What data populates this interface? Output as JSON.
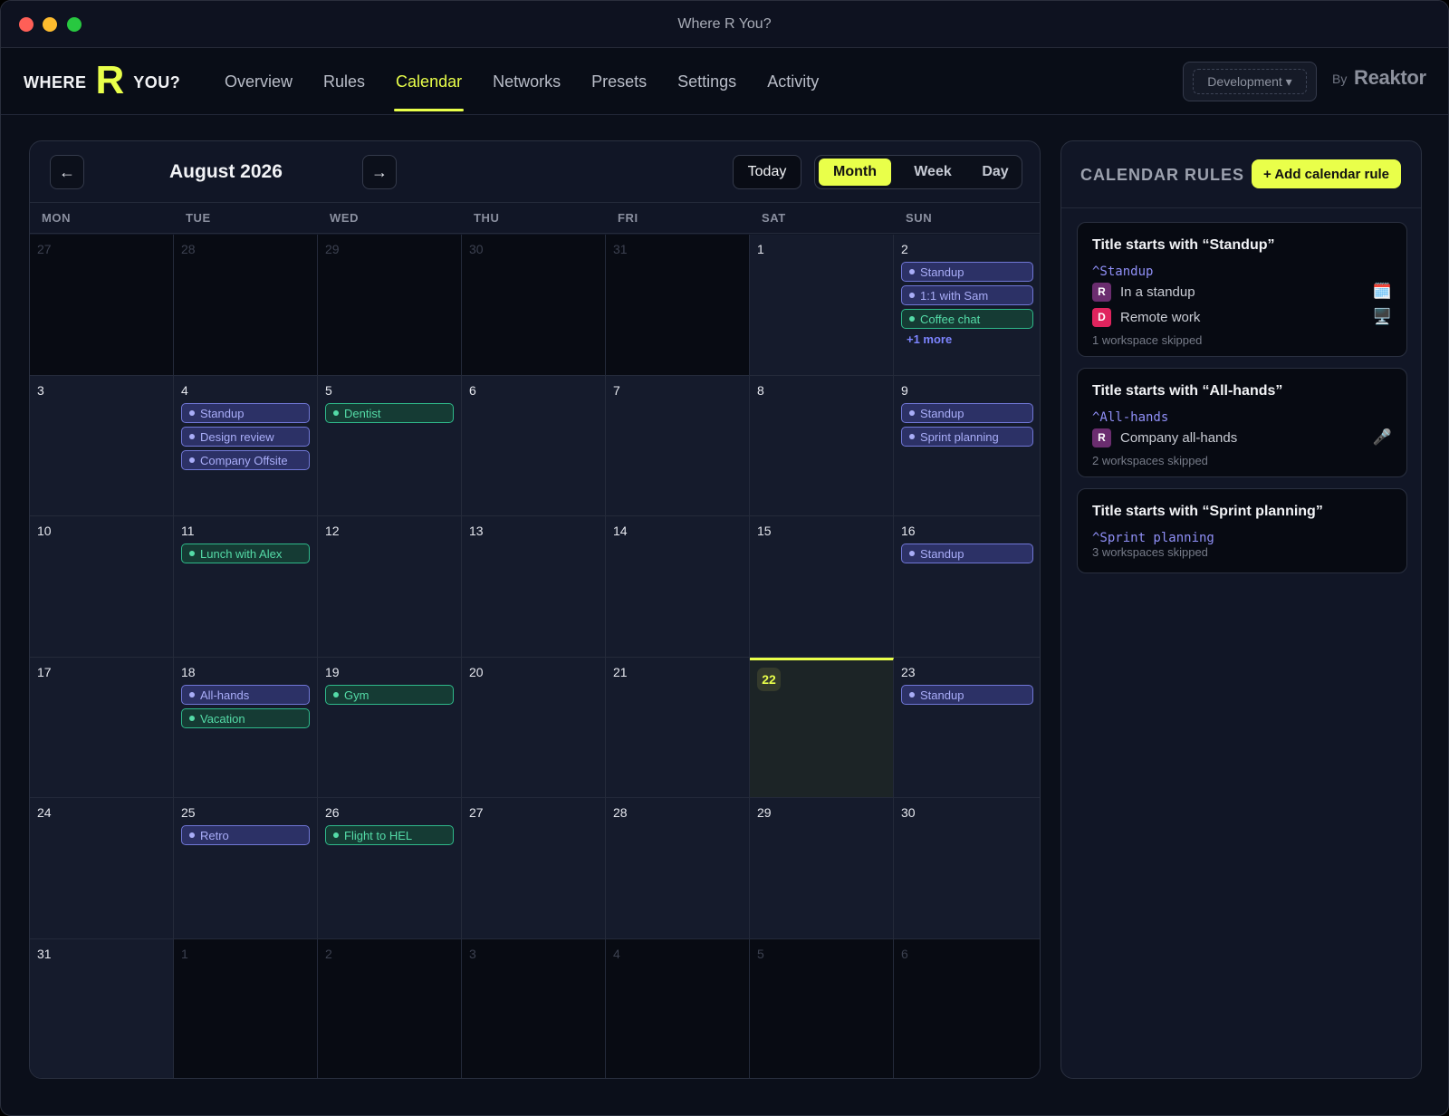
{
  "window": {
    "title": "Where R You?"
  },
  "logo": {
    "left": "WHERE",
    "mark": "R",
    "right": "YOU?"
  },
  "nav": {
    "tabs": [
      "Overview",
      "Rules",
      "Calendar",
      "Networks",
      "Presets",
      "Settings",
      "Activity"
    ],
    "active": "Calendar"
  },
  "environment": {
    "selected": "Development ▾"
  },
  "brand": {
    "by": "By",
    "name": "Reaktor"
  },
  "calendar": {
    "prev_label": "←",
    "next_label": "→",
    "month_title": "August 2026",
    "today_label": "Today",
    "views": [
      "Month",
      "Week",
      "Day"
    ],
    "active_view": "Month",
    "weekdays": [
      "MON",
      "TUE",
      "WED",
      "THU",
      "FRI",
      "SAT",
      "SUN"
    ],
    "today_day": "22",
    "more_label": "+1 more",
    "weeks": [
      [
        {
          "day": "27",
          "muted": true,
          "events": []
        },
        {
          "day": "28",
          "muted": true,
          "events": []
        },
        {
          "day": "29",
          "muted": true,
          "events": []
        },
        {
          "day": "30",
          "muted": true,
          "events": []
        },
        {
          "day": "31",
          "muted": true,
          "events": []
        },
        {
          "day": "1",
          "events": []
        },
        {
          "day": "2",
          "events": [
            {
              "title": "Standup",
              "color": "purple"
            },
            {
              "title": "1:1 with Sam",
              "color": "purple"
            },
            {
              "title": "Coffee chat",
              "color": "green"
            }
          ],
          "more": true
        }
      ],
      [
        {
          "day": "3",
          "events": []
        },
        {
          "day": "4",
          "events": [
            {
              "title": "Standup",
              "color": "purple"
            },
            {
              "title": "Design review",
              "color": "purple"
            },
            {
              "title": "Company Offsite",
              "color": "purple"
            }
          ]
        },
        {
          "day": "5",
          "events": [
            {
              "title": "Dentist",
              "color": "green"
            }
          ]
        },
        {
          "day": "6",
          "events": []
        },
        {
          "day": "7",
          "events": []
        },
        {
          "day": "8",
          "events": []
        },
        {
          "day": "9",
          "events": [
            {
              "title": "Standup",
              "color": "purple"
            },
            {
              "title": "Sprint planning",
              "color": "purple"
            }
          ]
        }
      ],
      [
        {
          "day": "10",
          "events": []
        },
        {
          "day": "11",
          "events": [
            {
              "title": "Lunch with Alex",
              "color": "green"
            }
          ]
        },
        {
          "day": "12",
          "events": []
        },
        {
          "day": "13",
          "events": []
        },
        {
          "day": "14",
          "events": []
        },
        {
          "day": "15",
          "events": []
        },
        {
          "day": "16",
          "events": [
            {
              "title": "Standup",
              "color": "purple"
            }
          ]
        }
      ],
      [
        {
          "day": "17",
          "events": []
        },
        {
          "day": "18",
          "events": [
            {
              "title": "All-hands",
              "color": "purple"
            },
            {
              "title": "Vacation",
              "color": "green"
            }
          ]
        },
        {
          "day": "19",
          "events": [
            {
              "title": "Gym",
              "color": "green"
            }
          ]
        },
        {
          "day": "20",
          "events": []
        },
        {
          "day": "21",
          "events": []
        },
        {
          "day": "22",
          "today": true,
          "events": []
        },
        {
          "day": "23",
          "events": [
            {
              "title": "Standup",
              "color": "purple"
            }
          ]
        }
      ],
      [
        {
          "day": "24",
          "events": []
        },
        {
          "day": "25",
          "events": [
            {
              "title": "Retro",
              "color": "purple"
            }
          ]
        },
        {
          "day": "26",
          "events": [
            {
              "title": "Flight to HEL",
              "color": "green"
            }
          ]
        },
        {
          "day": "27",
          "events": []
        },
        {
          "day": "28",
          "events": []
        },
        {
          "day": "29",
          "events": []
        },
        {
          "day": "30",
          "events": []
        }
      ],
      [
        {
          "day": "31",
          "events": []
        },
        {
          "day": "1",
          "muted": true,
          "events": []
        },
        {
          "day": "2",
          "muted": true,
          "events": []
        },
        {
          "day": "3",
          "muted": true,
          "events": []
        },
        {
          "day": "4",
          "muted": true,
          "events": []
        },
        {
          "day": "5",
          "muted": true,
          "events": []
        },
        {
          "day": "6",
          "muted": true,
          "events": []
        }
      ]
    ]
  },
  "rules_panel": {
    "title": "CALENDAR RULES",
    "add_label": "+ Add calendar rule",
    "rules": [
      {
        "title": "Title starts with “Standup”",
        "pattern": "^Standup",
        "workspaces": [
          {
            "initial": "R",
            "label": "In a standup",
            "emoji": "🗓️",
            "avatar_color": "#6b2d6f",
            "icon": "calendar-icon"
          },
          {
            "initial": "D",
            "label": "Remote work",
            "emoji": "🖥️",
            "avatar_color": "#e0245e",
            "icon": "computer-icon"
          }
        ],
        "skipped": "1 workspace skipped"
      },
      {
        "title": "Title starts with “All-hands”",
        "pattern": "^All-hands",
        "workspaces": [
          {
            "initial": "R",
            "label": "Company all-hands",
            "emoji": "🎤",
            "avatar_color": "#6b2d6f",
            "icon": "microphone-icon"
          }
        ],
        "skipped": "2 workspaces skipped"
      },
      {
        "title": "Title starts with “Sprint planning”",
        "pattern": "^Sprint planning",
        "workspaces": [],
        "skipped": "3 workspaces skipped"
      }
    ]
  },
  "colors": {
    "accent": "#e9ff4a",
    "event_purple": "#7077d6",
    "event_green": "#2fb98a"
  }
}
